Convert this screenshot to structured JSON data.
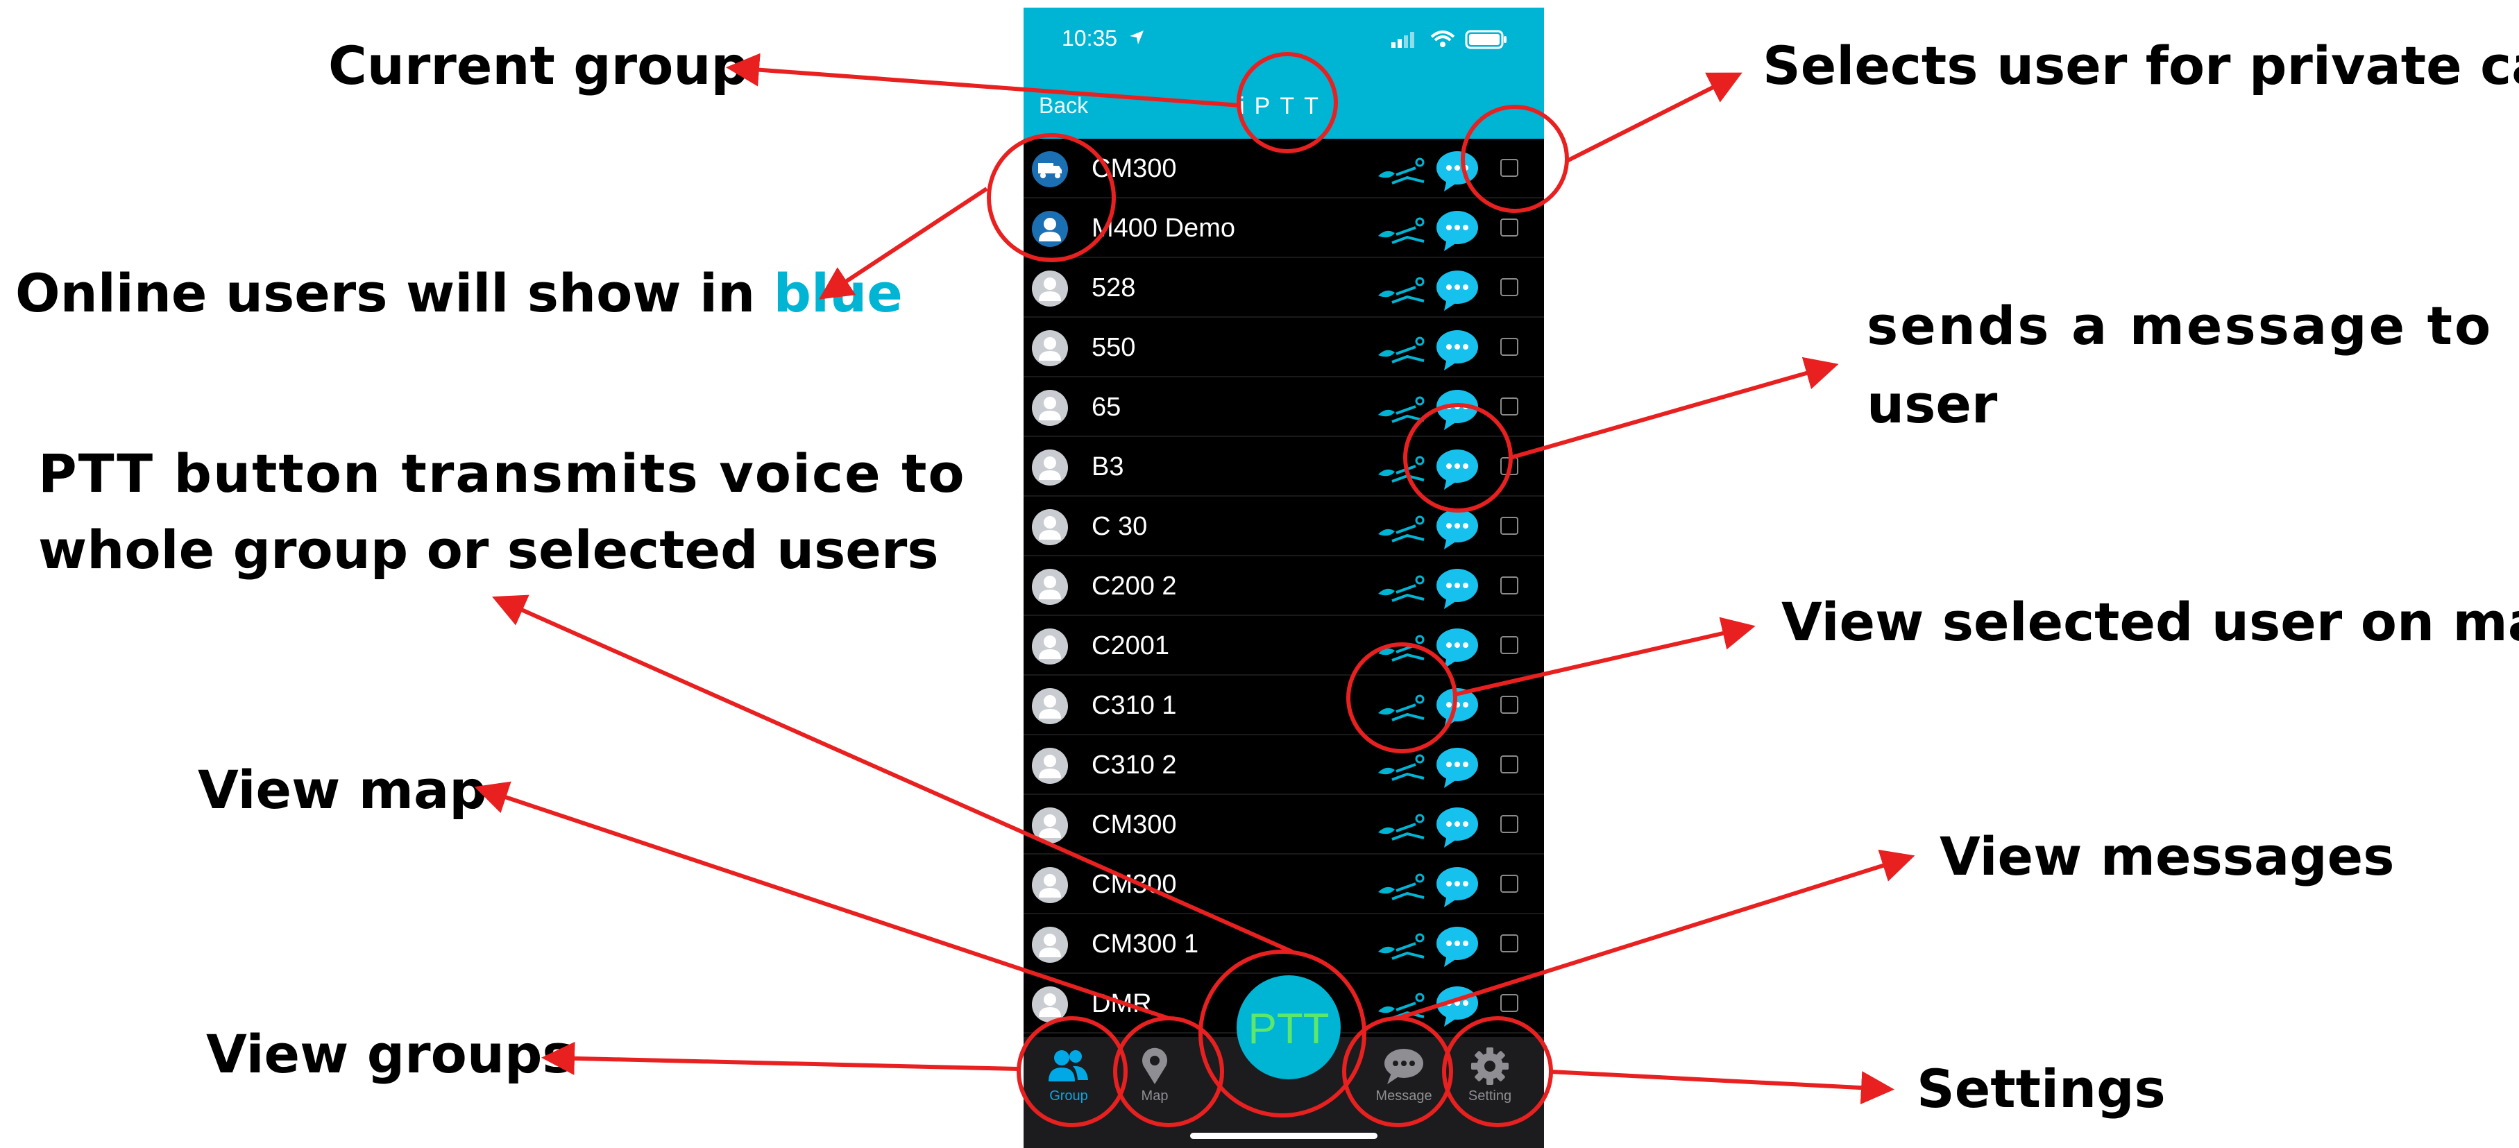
{
  "phone": {
    "status_time": "10:35",
    "title": "iPTT",
    "back_label": "Back",
    "accent_color": "#00b4d4",
    "users": [
      {
        "name": "CM300",
        "online": true,
        "avatar": "truck-icon"
      },
      {
        "name": "M400 Demo",
        "online": true,
        "avatar": "person-icon"
      },
      {
        "name": "528",
        "online": false,
        "avatar": "person-icon"
      },
      {
        "name": "550",
        "online": false,
        "avatar": "person-icon"
      },
      {
        "name": "65",
        "online": false,
        "avatar": "person-icon"
      },
      {
        "name": "B3",
        "online": false,
        "avatar": "person-icon"
      },
      {
        "name": "C 30",
        "online": false,
        "avatar": "person-icon"
      },
      {
        "name": "C200 2",
        "online": false,
        "avatar": "person-icon"
      },
      {
        "name": "C2001",
        "online": false,
        "avatar": "person-icon"
      },
      {
        "name": "C310 1",
        "online": false,
        "avatar": "person-icon"
      },
      {
        "name": "C310 2",
        "online": false,
        "avatar": "person-icon"
      },
      {
        "name": "CM300",
        "online": false,
        "avatar": "person-icon"
      },
      {
        "name": "CM300",
        "online": false,
        "avatar": "person-icon"
      },
      {
        "name": "CM300 1",
        "online": false,
        "avatar": "person-icon"
      },
      {
        "name": "DMR",
        "online": false,
        "avatar": "person-icon"
      }
    ],
    "ptt_label": "PTT",
    "tabs": [
      {
        "label": "Group",
        "icon": "group-icon",
        "active": true
      },
      {
        "label": "Map",
        "icon": "map-pin-icon",
        "active": false
      },
      {
        "label": "Message",
        "icon": "message-icon",
        "active": false
      },
      {
        "label": "Setting",
        "icon": "gear-icon",
        "active": false
      }
    ]
  },
  "annotations": {
    "current_group": "Current group",
    "private_call": "Selects user for private call",
    "online_users_prefix": "Online users will show in ",
    "online_users_blue": "blue",
    "send_message_line1": "sends a message to",
    "send_message_line2": "user",
    "ptt_line1": "PTT button transmits voice to",
    "ptt_line2": "whole group or selected users",
    "view_selected_map": "View selected user on map",
    "view_map": "View map",
    "view_messages": "View messages",
    "view_groups": "View groups",
    "settings": "Settings"
  },
  "colors": {
    "annotation_arrow": "#e82020",
    "online_blue": "#00b4d4"
  }
}
